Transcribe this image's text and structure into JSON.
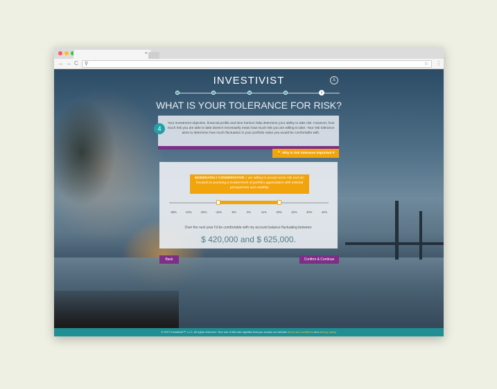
{
  "brand": {
    "logo_text": "INVESTIVIST"
  },
  "tab": {
    "close": "×"
  },
  "nav": {
    "back": "←",
    "forward": "→",
    "reload": "C",
    "url": "",
    "url_icon": "search-icon",
    "star": "☆",
    "menu": "⋮"
  },
  "progress": {
    "current_step": 5,
    "total_steps": 5,
    "steps": [
      "1",
      "2",
      "3",
      "4",
      "5"
    ]
  },
  "page": {
    "title": "WHAT IS YOUR TOLERANCE FOR RISK?",
    "step_badge": "4"
  },
  "intro": {
    "text": "Your investment objective, financial profile and time horizon help determine your ability to take risk. However, how much risk you are able to take doesn't necessarily mean how much risk you are willing to take. Your risk tolerance aims to determine how much fluctuation in your portfolio value you would be comfortable with.",
    "why_button": "Why is risk tolerance important ▾"
  },
  "risk": {
    "level_label": "MODERATELY CONSERVATIVE:",
    "level_text": "I am willing to accept some risk and am focused on pursuing a modest level of portfolio appreciation with minimal principal loss and volatility.",
    "ticks": [
      "-38%",
      "-34%",
      "-25%",
      "-16%",
      "-8%",
      "0%",
      "11%",
      "20%",
      "32%",
      "40%",
      "44%"
    ],
    "range_low_index": 3,
    "range_high_index": 7,
    "balance_desc": "Over the next year I'd be comfortable with my account balance fluctuating between:",
    "low_value": "$ 420,000",
    "and_word": "and",
    "high_value": "$ 625,000."
  },
  "buttons": {
    "back": "Back",
    "confirm": "Confirm & Continue"
  },
  "footer": {
    "text_before": "© 2017 Investivist™, LLC. All rights reserved. Your use of this site signifies that you accept our website",
    "terms": "terms and conditions",
    "and": "and",
    "privacy": "privacy policy."
  },
  "colors": {
    "accent_teal": "#1f8f93",
    "accent_orange": "#f2a40d",
    "accent_purple": "#7e2e86"
  }
}
